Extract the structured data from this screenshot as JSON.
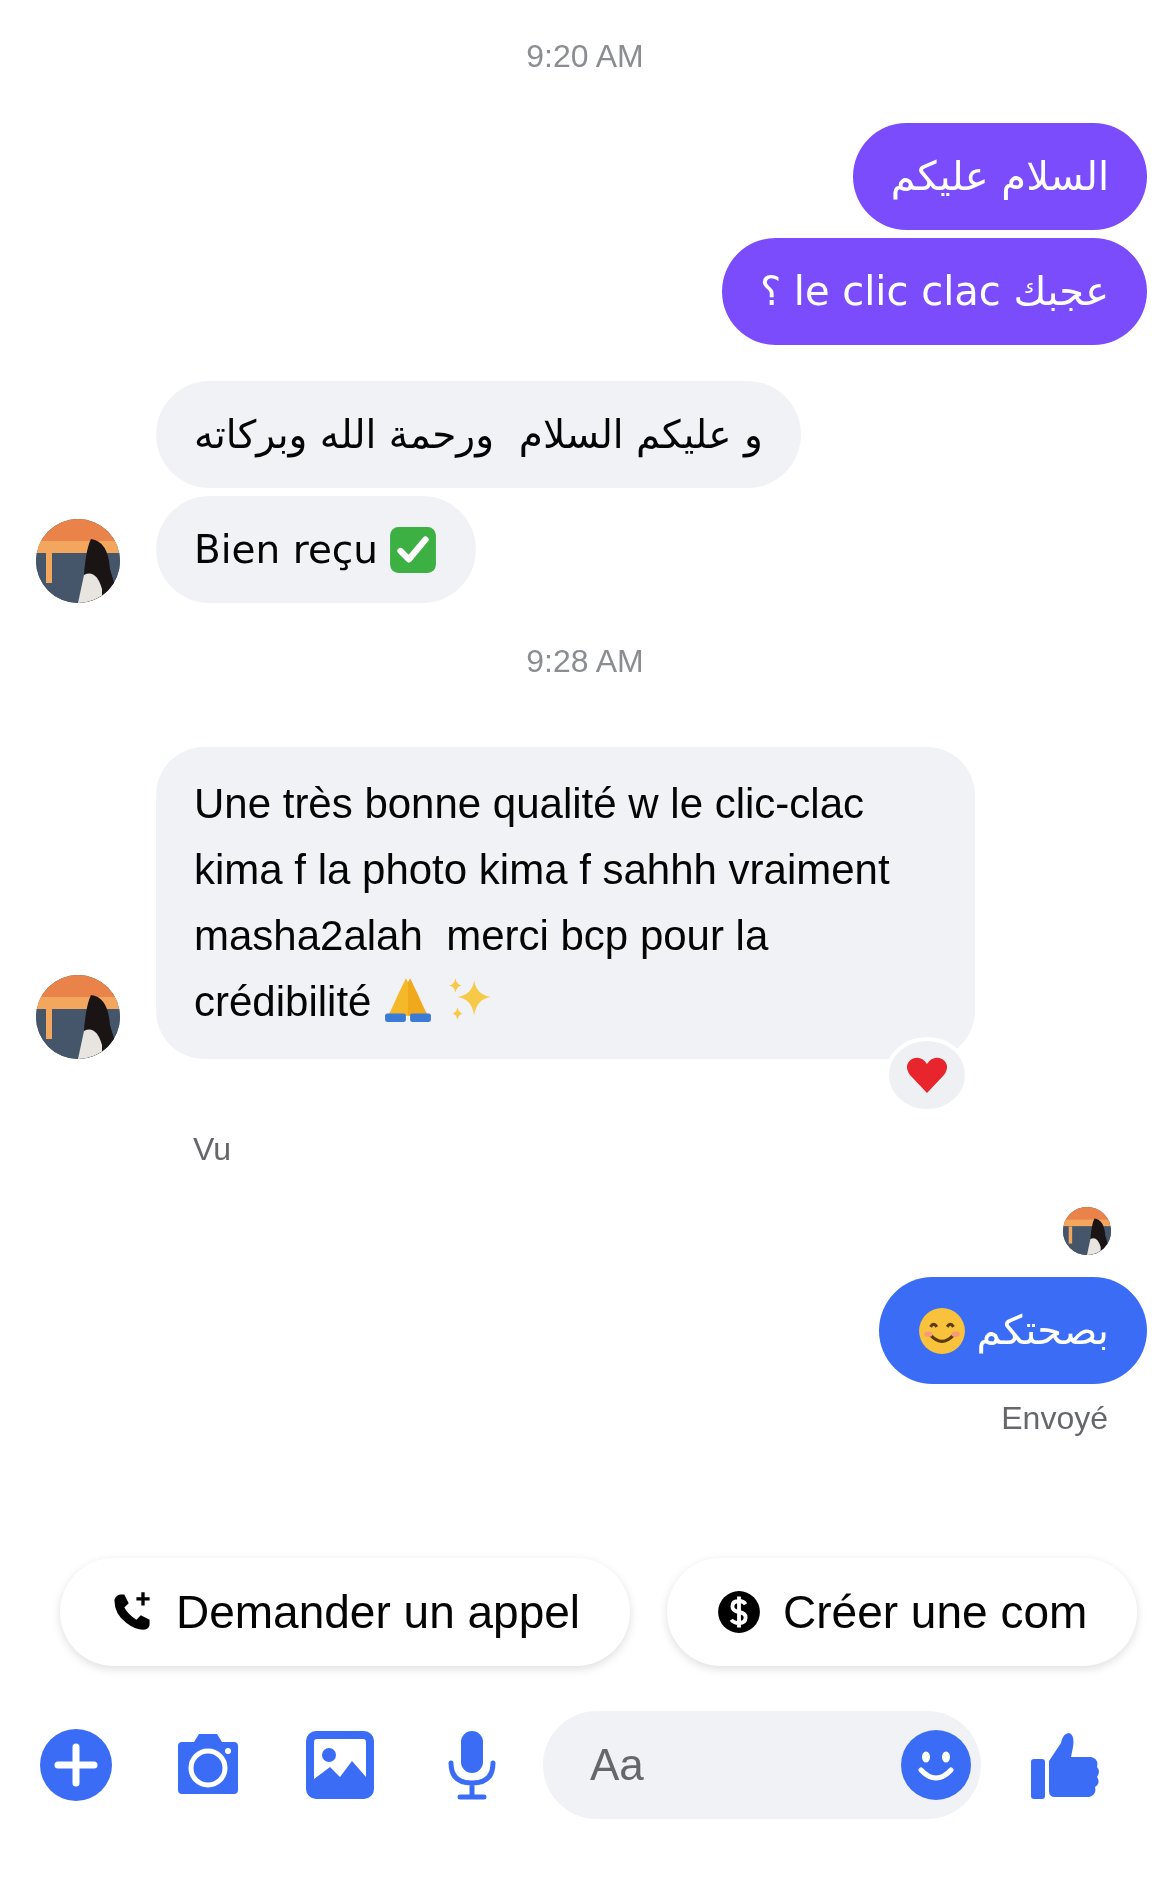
{
  "messages": [
    {
      "kind": "timestamp",
      "text": "9:20 AM"
    },
    {
      "kind": "sent",
      "text": "السلام عليكم",
      "color": "#7b4cfb"
    },
    {
      "kind": "sent",
      "text": "عجبك le clic clac ؟",
      "color": "#7b4cfb"
    },
    {
      "kind": "received_group",
      "bubbles": [
        {
          "text": "و عليكم السلام  ورحمة الله وبركاته"
        },
        {
          "text": "Bien reçu"
        }
      ]
    },
    {
      "kind": "timestamp",
      "text": "9:28 AM"
    },
    {
      "kind": "received_group",
      "bubbles": [
        {
          "text": "Une très bonne qualité w le clic-clac kima f la photo kima f sahhh vraiment masha2alah  merci bcp pour la crédibilité"
        }
      ]
    },
    {
      "kind": "seen_label",
      "text": "Vu"
    },
    {
      "kind": "seen_avatar"
    },
    {
      "kind": "sent",
      "text": "بصحتكم",
      "color": "#3b6cf5"
    },
    {
      "kind": "status",
      "text": "Envoyé"
    }
  ],
  "chips": [
    {
      "label": "Demander un appel"
    },
    {
      "label": "Créer une com"
    }
  ],
  "composer": {
    "placeholder": "Aa"
  }
}
